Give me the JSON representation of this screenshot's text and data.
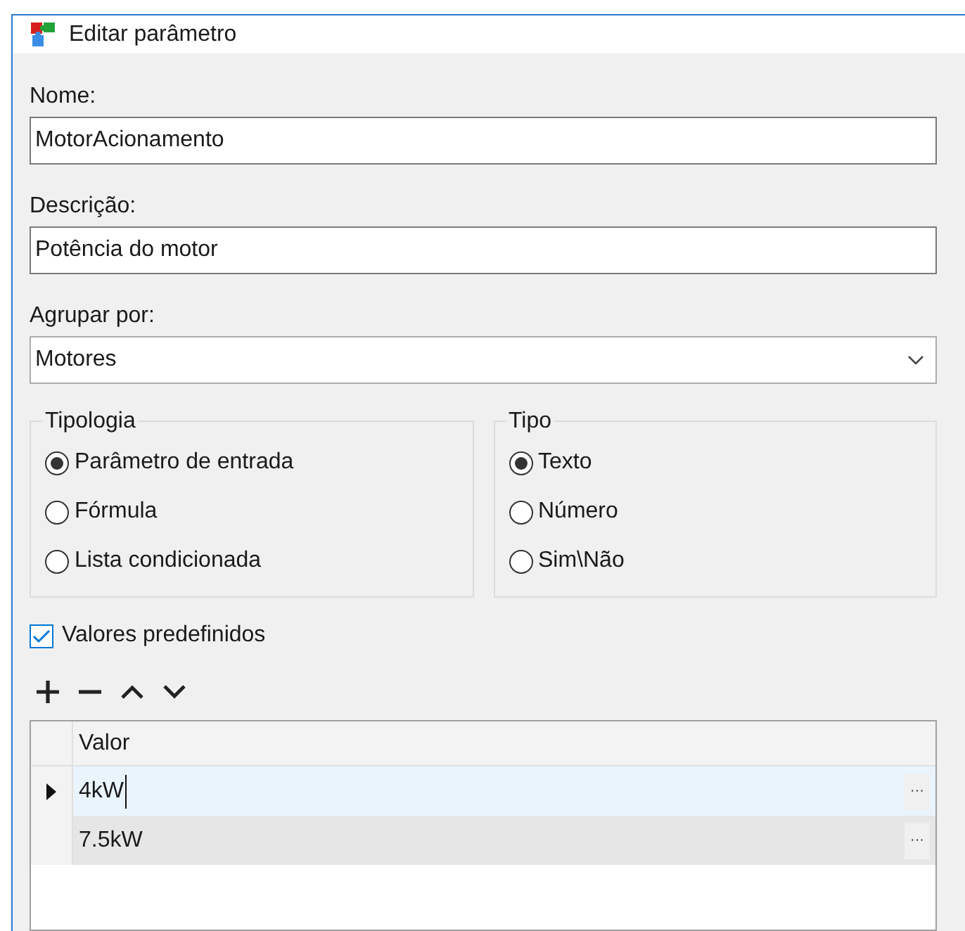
{
  "window": {
    "title": "Editar parâmetro"
  },
  "fields": [
    {
      "label": "Nome:",
      "value": "MotorAcionamento",
      "kind": "text"
    },
    {
      "label": "Descrição:",
      "value": "Potência do motor",
      "kind": "text"
    },
    {
      "label": "Agrupar por:",
      "value": "Motores",
      "kind": "dropdown"
    }
  ],
  "groups": [
    {
      "title": "Tipologia",
      "options": [
        {
          "label": "Parâmetro de entrada",
          "selected": true
        },
        {
          "label": "Fórmula",
          "selected": false
        },
        {
          "label": "Lista condicionada",
          "selected": false
        }
      ]
    },
    {
      "title": "Tipo",
      "options": [
        {
          "label": "Texto",
          "selected": true
        },
        {
          "label": "Número",
          "selected": false
        },
        {
          "label": "Sim\\Não",
          "selected": false
        }
      ]
    }
  ],
  "predefined": {
    "label": "Valores predefinidos",
    "checked": true
  },
  "toolbar": [
    {
      "kind": "add"
    },
    {
      "kind": "remove"
    },
    {
      "kind": "up"
    },
    {
      "kind": "down"
    }
  ],
  "grid": {
    "columns": [
      "Valor"
    ],
    "rows": [
      {
        "value": "4kW",
        "selected": true,
        "button": "···"
      },
      {
        "value": "7.5kW",
        "selected": false,
        "button": "···"
      }
    ]
  }
}
